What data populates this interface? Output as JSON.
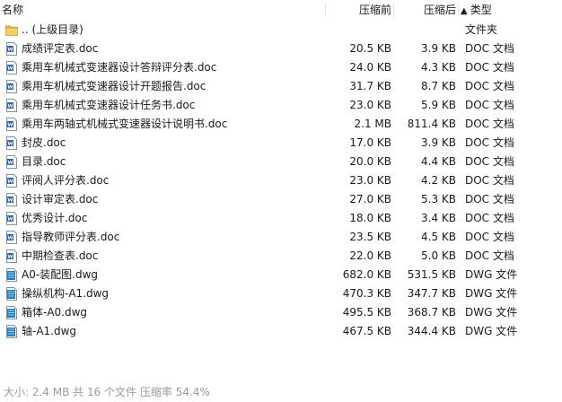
{
  "header": {
    "name": "名称",
    "size": "压缩前",
    "packed": "压缩后",
    "type_arrow": "▲",
    "type": "类型"
  },
  "rows": [
    {
      "icon": "folder-icon",
      "name": ".. (上级目录)",
      "size": "",
      "packed": "",
      "type": "文件夹"
    },
    {
      "icon": "doc-file-icon",
      "name": "成绩评定表.doc",
      "size": "20.5 KB",
      "packed": "3.9 KB",
      "type": "DOC 文档"
    },
    {
      "icon": "doc-file-icon",
      "name": "乘用车机械式变速器设计答辩评分表.doc",
      "size": "24.0 KB",
      "packed": "4.3 KB",
      "type": "DOC 文档"
    },
    {
      "icon": "doc-file-icon",
      "name": "乘用车机械式变速器设计开题报告.doc",
      "size": "31.7 KB",
      "packed": "8.7 KB",
      "type": "DOC 文档"
    },
    {
      "icon": "doc-file-icon",
      "name": "乘用车机械式变速器设计任务书.doc",
      "size": "23.0 KB",
      "packed": "5.9 KB",
      "type": "DOC 文档"
    },
    {
      "icon": "doc-file-icon",
      "name": "乘用车两轴式机械式变速器设计说明书.doc",
      "size": "2.1 MB",
      "packed": "811.4 KB",
      "type": "DOC 文档"
    },
    {
      "icon": "doc-file-icon",
      "name": "封皮.doc",
      "size": "17.0 KB",
      "packed": "3.9 KB",
      "type": "DOC 文档"
    },
    {
      "icon": "doc-file-icon",
      "name": "目录.doc",
      "size": "20.0 KB",
      "packed": "4.4 KB",
      "type": "DOC 文档"
    },
    {
      "icon": "doc-file-icon",
      "name": "评阅人评分表.doc",
      "size": "23.0 KB",
      "packed": "4.2 KB",
      "type": "DOC 文档"
    },
    {
      "icon": "doc-file-icon",
      "name": "设计审定表.doc",
      "size": "27.0 KB",
      "packed": "5.3 KB",
      "type": "DOC 文档"
    },
    {
      "icon": "doc-file-icon",
      "name": "优秀设计.doc",
      "size": "18.0 KB",
      "packed": "3.4 KB",
      "type": "DOC 文档"
    },
    {
      "icon": "doc-file-icon",
      "name": "指导教师评分表.doc",
      "size": "23.5 KB",
      "packed": "4.5 KB",
      "type": "DOC 文档"
    },
    {
      "icon": "doc-file-icon",
      "name": "中期检查表.doc",
      "size": "22.0 KB",
      "packed": "5.0 KB",
      "type": "DOC 文档"
    },
    {
      "icon": "dwg-file-icon",
      "name": "A0-装配图.dwg",
      "size": "682.0 KB",
      "packed": "531.5 KB",
      "type": "DWG 文件"
    },
    {
      "icon": "dwg-file-icon",
      "name": "操纵机构-A1.dwg",
      "size": "470.3 KB",
      "packed": "347.7 KB",
      "type": "DWG 文件"
    },
    {
      "icon": "dwg-file-icon",
      "name": "箱体-A0.dwg",
      "size": "495.5 KB",
      "packed": "368.7 KB",
      "type": "DWG 文件"
    },
    {
      "icon": "dwg-file-icon",
      "name": "轴-A1.dwg",
      "size": "467.5 KB",
      "packed": "344.4 KB",
      "type": "DWG 文件"
    }
  ],
  "status": "大小: 2.4 MB 共 16 个文件 压缩率 54.4%",
  "colors": {
    "folder": "#e8b94a",
    "doc": "#2b5fb4",
    "dwg": "#1f7fc4",
    "status_text": "#9a9a9a"
  }
}
